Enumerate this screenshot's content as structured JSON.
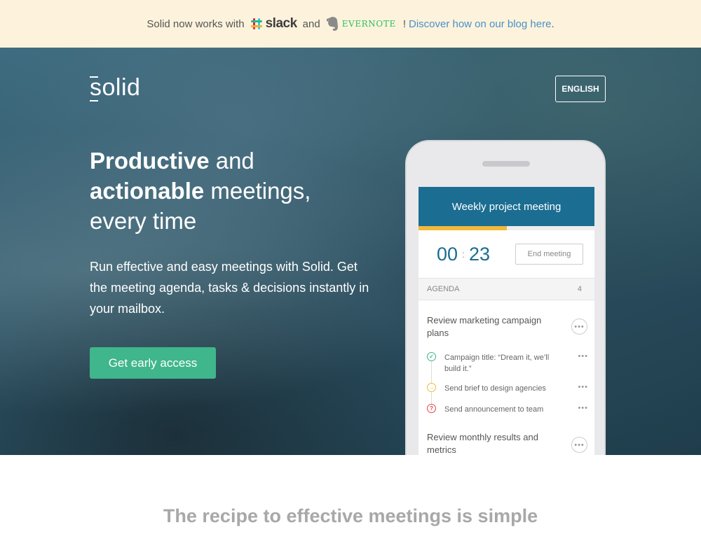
{
  "announcement": {
    "prefix": "Solid now works with",
    "slack": "slack",
    "and": "and",
    "evernote": "EVERNOTE",
    "exclaim": "!",
    "link": "Discover how on our blog here",
    "period": "."
  },
  "header": {
    "logo": "solid",
    "language_button": "ENGLISH"
  },
  "hero": {
    "headline_bold_1": "Productive",
    "headline_1": " and",
    "headline_bold_2": "actionable",
    "headline_2": " meetings,",
    "headline_3": "every time",
    "subtext": "Run effective and easy meetings with Solid. Get the meeting agenda, tasks & decisions instantly in your mailbox.",
    "cta": "Get early access"
  },
  "phone": {
    "meeting_title": "Weekly project meeting",
    "progress": 0.5,
    "timer_minutes": "00",
    "timer_seconds": "23",
    "end_button": "End meeting",
    "agenda_label": "AGENDA",
    "agenda_count": "4",
    "items": [
      {
        "title": "Review marketing campaign plans",
        "subitems": [
          {
            "text": "Campaign title: “Dream it, we’ll build it.”",
            "status": "decision",
            "color": "#3fb68b"
          },
          {
            "text": "Send brief to design agencies",
            "status": "task",
            "color": "#f0b93a"
          },
          {
            "text": "Send announcement to team",
            "status": "question",
            "color": "#e0473f"
          }
        ]
      },
      {
        "title": "Review monthly results and metrics"
      }
    ]
  },
  "section": {
    "title": "The recipe to effective meetings is simple"
  },
  "colors": {
    "announce_bg": "#fdf3dc",
    "link": "#4a90c9",
    "cta": "#3fb68b",
    "meeting_header": "#1b6d91",
    "progress": "#f0b93a"
  }
}
